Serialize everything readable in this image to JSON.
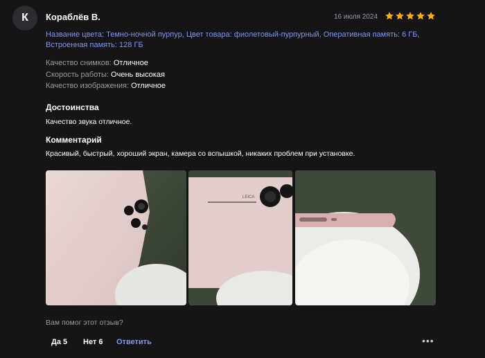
{
  "review": {
    "avatar_letter": "К",
    "author": "Кораблёв В.",
    "date": "16 июля 2024",
    "rating": 5,
    "star_color": "#ffb300",
    "params": "Название цвета: Темно-ночной пурпур, Цвет товара: фиолетовый-пурпурный, Оперативная память: 6 ГБ, Встроенная память: 128 ГБ",
    "attributes": [
      {
        "name": "Качество снимков:",
        "value": "Отличное"
      },
      {
        "name": "Скорость работы:",
        "value": "Очень высокая"
      },
      {
        "name": "Качество изображения:",
        "value": "Отличное"
      }
    ],
    "advantages_title": "Достоинства",
    "advantages_text": "Качество звука отличное.",
    "comment_title": "Комментарий",
    "comment_text": "Красивый, быстрый, хороший экран, камера со вспышкой, никаких проблем при установке.",
    "photo_brand_text": "LEICA"
  },
  "footer": {
    "question": "Вам помог этот отзыв?",
    "yes_label": "Да 5",
    "no_label": "Нет 6",
    "reply_label": "Ответить",
    "more_icon": "more-dots-icon"
  }
}
